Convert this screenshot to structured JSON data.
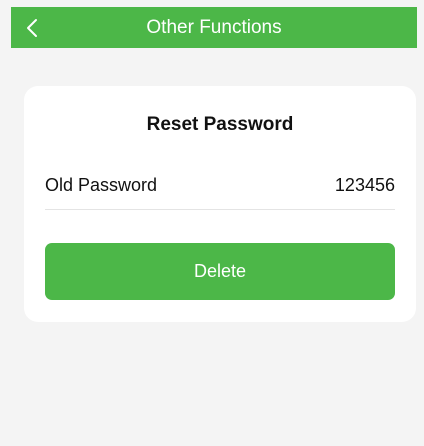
{
  "header": {
    "title": "Other Functions",
    "back_icon": "chevron-left-icon",
    "background_color": "#4cb748"
  },
  "card": {
    "title": "Reset Password",
    "field": {
      "label": "Old Password",
      "value": "123456"
    },
    "delete_button_label": "Delete",
    "accent_color": "#4cb748"
  }
}
